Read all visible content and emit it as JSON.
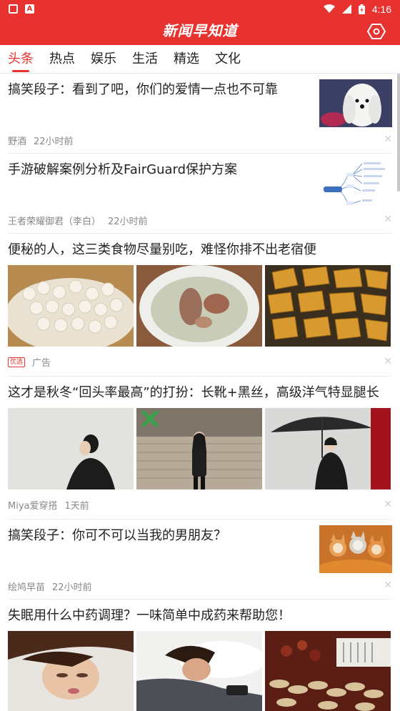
{
  "status_bar": {
    "time": "4:16"
  },
  "app": {
    "title": "新闻早知道"
  },
  "tabs": [
    {
      "label": "头条",
      "active": true
    },
    {
      "label": "热点"
    },
    {
      "label": "娱乐"
    },
    {
      "label": "生活"
    },
    {
      "label": "精选"
    },
    {
      "label": "文化"
    }
  ],
  "feed": [
    {
      "title": "搞笑段子：看到了吧，你们的爱情一点也不可靠",
      "source": "野酒",
      "time": "22小时前"
    },
    {
      "title": "手游破解案例分析及FairGuard保护方案",
      "source": "王者荣耀御君（李白）",
      "time": "22小时前"
    },
    {
      "title": "便秘的人，这三类食物尽量别吃，难怪你排不出老宿便",
      "badge": "优选",
      "source": "广告"
    },
    {
      "title": "这才是秋冬“回头率最高”的打扮：长靴+黑丝，高级洋气特显腿长",
      "source": "Miya爱穿搭",
      "time": "1天前"
    },
    {
      "title": "搞笑段子：你可不可以当我的男朋友？",
      "source": "绘鸠早苗",
      "time": "22小时前"
    },
    {
      "title": "失眠用什么中药调理？一味简单中成药来帮助您！"
    }
  ],
  "colors": {
    "accent": "#e8322f"
  }
}
